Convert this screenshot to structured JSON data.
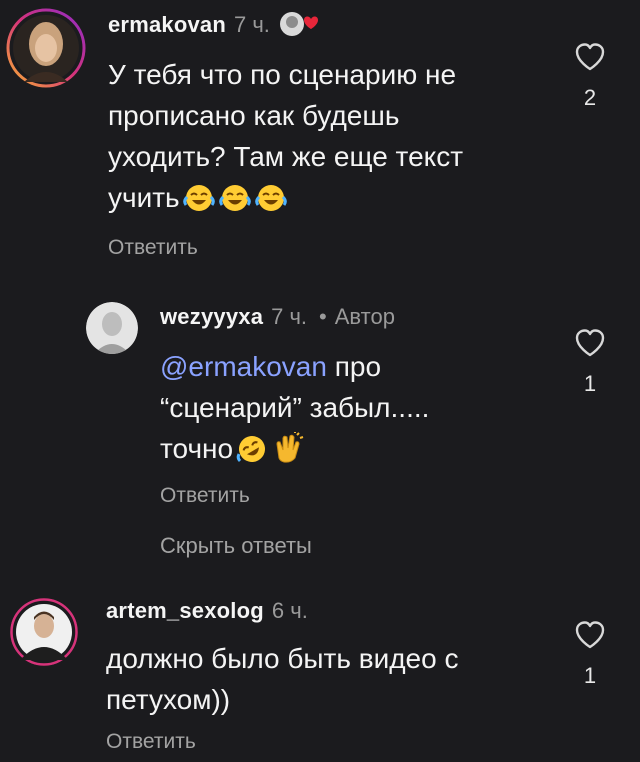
{
  "comments": [
    {
      "username": "ermakovan",
      "time": "7 ч.",
      "text": "У тебя что по сценарию не прописано как будешь уходить? Там же еще текст учить",
      "text_lines": [
        "У тебя что по сценарию не",
        "прописано как будешь",
        "уходить? Там же еще текст",
        "учить"
      ],
      "reaction_icons": [
        "tears-of-joy-emoji",
        "tears-of-joy-emoji",
        "tears-of-joy-emoji"
      ],
      "reply_label": "Ответить",
      "likes": "2"
    },
    {
      "username": "wezyyyxa",
      "time": "7 ч.",
      "dot": "•",
      "author_badge": "Автор",
      "mention": "@ermakovan",
      "text_lines": [
        " про",
        "“сценарий” забыл.....",
        "точно"
      ],
      "reaction_icons": [
        "rolling-laughing-emoji",
        "clapping-hands-emoji"
      ],
      "reply_label": "Ответить",
      "likes": "1"
    },
    {
      "username": "artem_sexolog",
      "time": "6 ч.",
      "text_lines": [
        "должно было быть видео с",
        "петухом))"
      ],
      "reply_label": "Ответить",
      "likes": "1"
    }
  ],
  "hide_replies_label": "Скрыть ответы",
  "colors": {
    "background": "#1b1b1e",
    "mention": "#8aa2ff",
    "story_ring": "#d6337a",
    "heart_badge": "#e8263a"
  }
}
